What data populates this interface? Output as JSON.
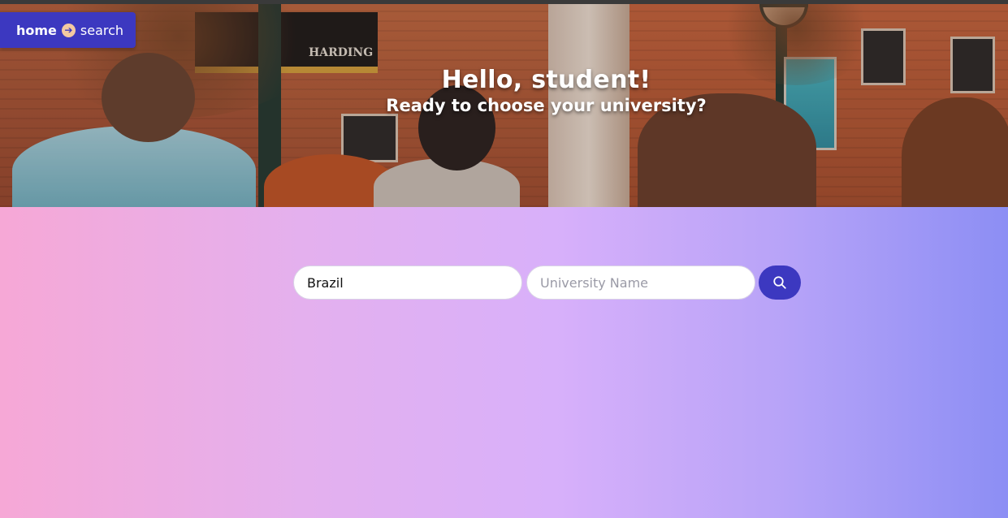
{
  "nav": {
    "home_label": "home",
    "search_label": "search"
  },
  "hero": {
    "title": "Hello, student!",
    "subtitle": "Ready to choose your university?",
    "banner_text": "HARDING"
  },
  "search": {
    "country_value": "Brazil",
    "university_value": "",
    "university_placeholder": "University Name"
  },
  "colors": {
    "accent": "#3c38c0",
    "arrow_badge": "#f3c9a1",
    "gradient_left": "#f6a8d6",
    "gradient_mid": "#d8b0fa",
    "gradient_right": "#8c8ef4"
  },
  "icons": {
    "search_button": "search-icon",
    "breadcrumb_separator": "arrow-right-circle-icon"
  }
}
